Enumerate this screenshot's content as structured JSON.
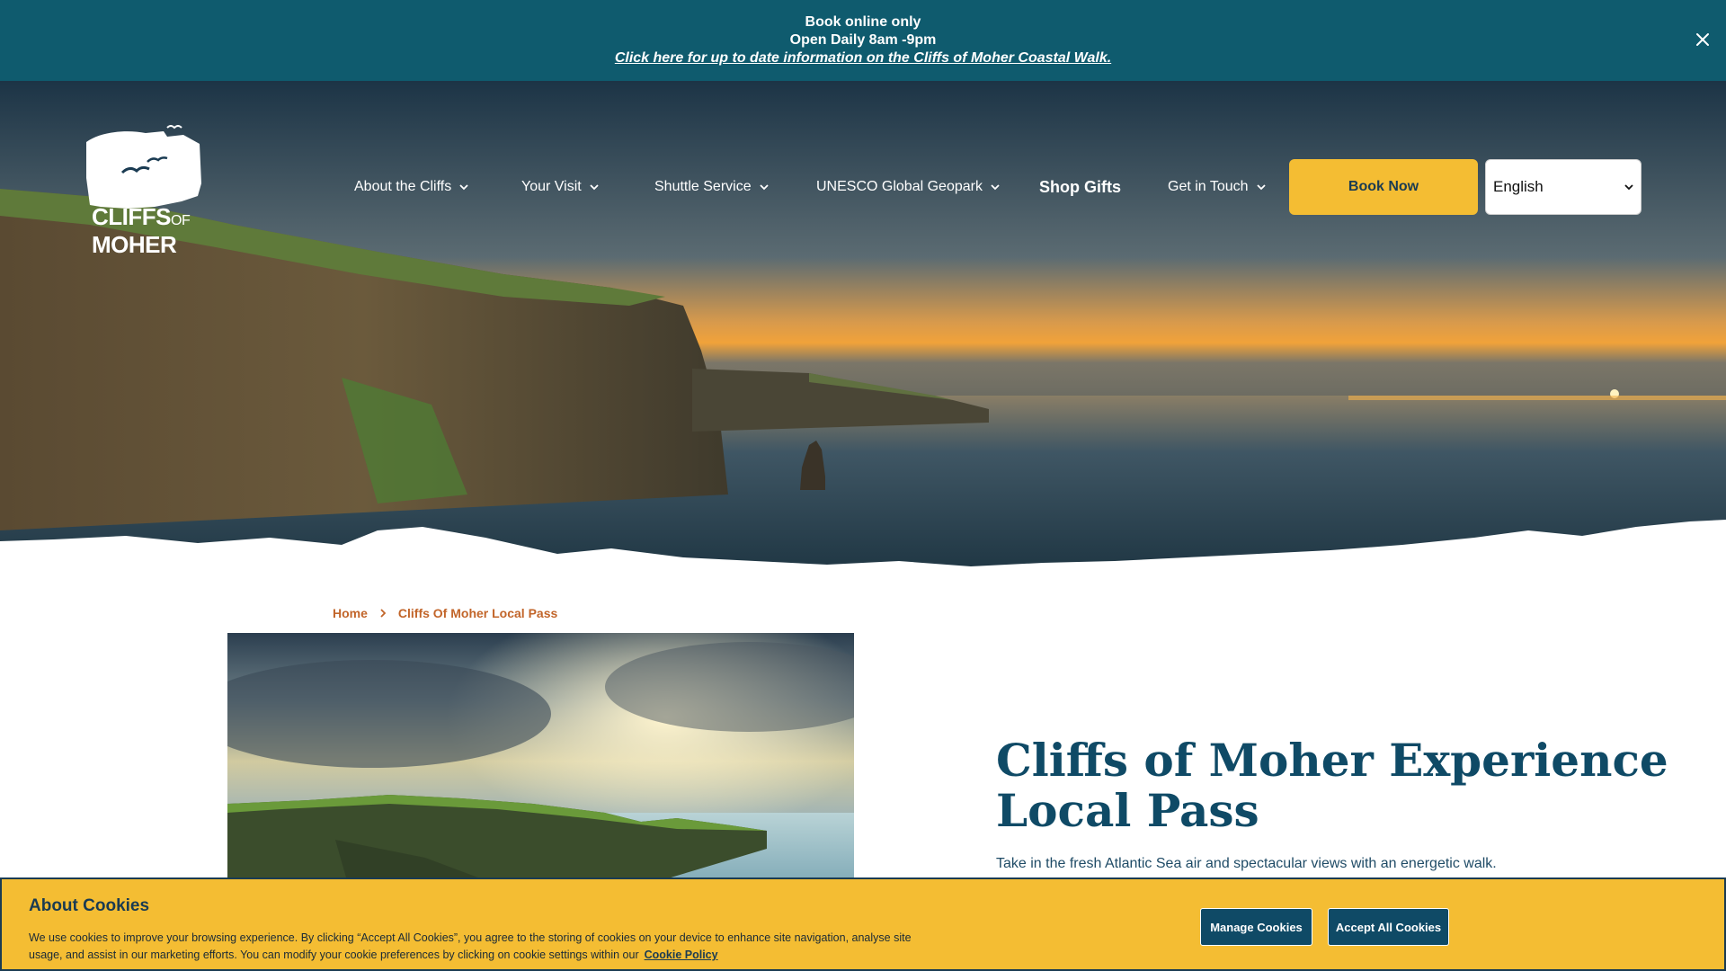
{
  "announcement": {
    "line1": "Book online only",
    "line2": "Open Daily 8am -9pm",
    "link": "Click here for up to date information on the Cliffs of Moher Coastal Walk.",
    "close_icon": "close-icon"
  },
  "logo": {
    "line1": "CLIFFS",
    "of": "OF",
    "line2": "MOHER"
  },
  "nav": {
    "items": [
      {
        "label": "About the Cliffs",
        "icon": "chevron-down-icon"
      },
      {
        "label": "Your Visit",
        "icon": "chevron-down-icon"
      },
      {
        "label": "Shuttle Service",
        "icon": "chevron-down-icon"
      },
      {
        "label": "UNESCO Global Geopark",
        "icon": "chevron-down-icon"
      },
      {
        "label": "Shop Gifts"
      },
      {
        "label": "Get in Touch",
        "icon": "chevron-down-icon"
      }
    ],
    "book_now": "Book Now",
    "language": "English"
  },
  "breadcrumb": {
    "home": "Home",
    "current": "Cliffs Of Moher Local Pass"
  },
  "main": {
    "title": "Cliffs of Moher Experience Local Pass",
    "lead": "Take in the fresh Atlantic Sea air and spectacular views with an energetic walk."
  },
  "cookie": {
    "title": "About Cookies",
    "text": "We use cookies to improve your browsing experience. By clicking “Accept All Cookies”, you agree to the storing of cookies on your device to enhance site navigation, analyse site usage, and assist in our marketing efforts. You can modify your cookie preferences by clicking on cookie settings within our",
    "policy_link": "Cookie Policy",
    "manage": "Manage Cookies",
    "accept": "Accept All Cookies"
  },
  "colors": {
    "announcement_bg": "#0f5b6e",
    "accent_yellow": "#f4bd33",
    "navy": "#0f4a66",
    "breadcrumb": "#c2652a"
  }
}
